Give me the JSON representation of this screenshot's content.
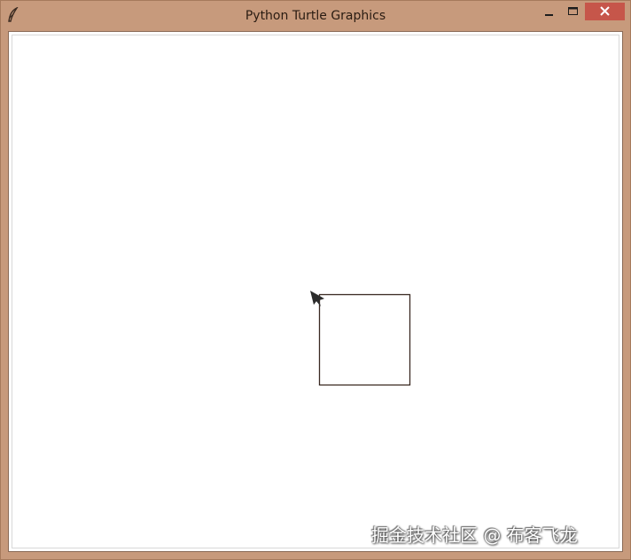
{
  "window": {
    "title": "Python Turtle Graphics",
    "frame_color": "#c79a7c",
    "close_color": "#c6564a"
  },
  "icons": {
    "app": "feather-icon",
    "minimize": "minimize-icon",
    "maximize": "maximize-icon",
    "close": "close-icon"
  },
  "drawing": {
    "shape": "square",
    "stroke_color": "#3a2a22",
    "turtle_color": "#2b2b2b",
    "turtle_heading": "up-left"
  },
  "watermark": {
    "text": "掘金技术社区 @ 布客飞龙"
  }
}
